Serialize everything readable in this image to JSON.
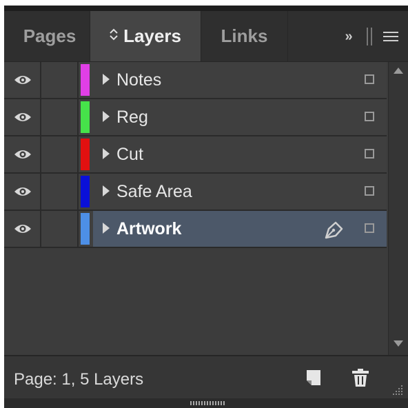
{
  "tabs": [
    {
      "label": "Pages",
      "active": false
    },
    {
      "label": "Layers",
      "active": true
    },
    {
      "label": "Links",
      "active": false
    }
  ],
  "layers_tab_chevron": "◊",
  "overflow_label": "»",
  "layers": [
    {
      "name": "Notes",
      "color": "#e03fe6",
      "visible": true,
      "selected": false
    },
    {
      "name": "Reg",
      "color": "#46e24a",
      "visible": true,
      "selected": false
    },
    {
      "name": "Cut",
      "color": "#e21010",
      "visible": true,
      "selected": false
    },
    {
      "name": "Safe Area",
      "color": "#0a10d8",
      "visible": true,
      "selected": false
    },
    {
      "name": "Artwork",
      "color": "#4d8fe6",
      "visible": true,
      "selected": true
    }
  ],
  "footer": {
    "status": "Page: 1, 5 Layers",
    "new_layer_icon": "new-layer-icon",
    "delete_icon": "trash-icon"
  },
  "colors": {
    "panel_bg": "#3c3c3c",
    "selected_row": "#4c5869"
  }
}
